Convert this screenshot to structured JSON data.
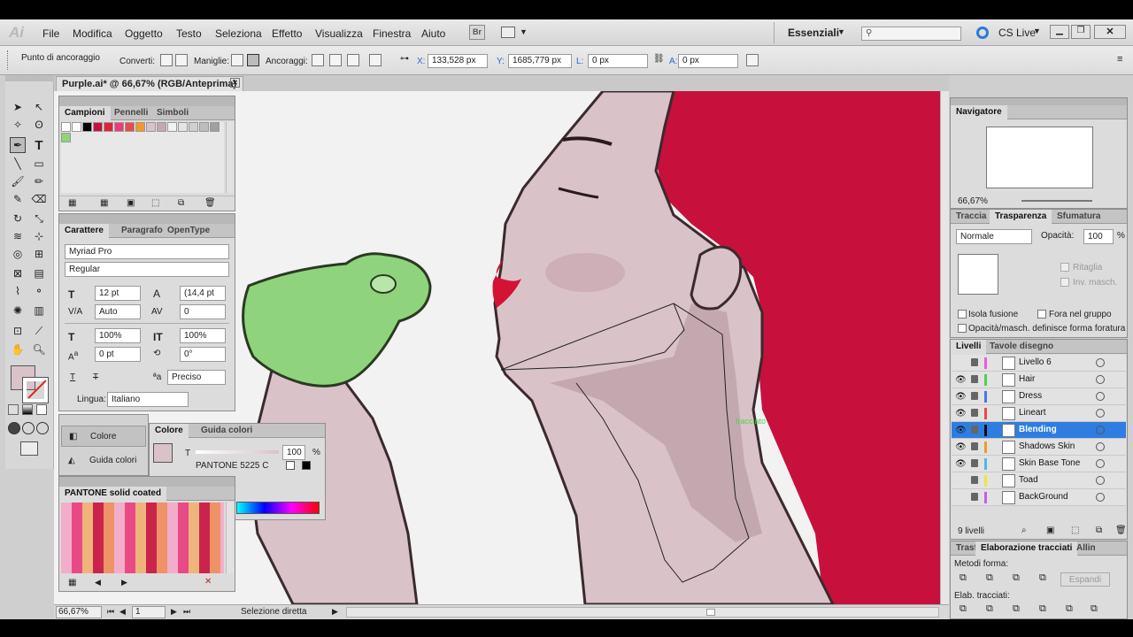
{
  "app": {
    "logo": "Ai",
    "menu": [
      "File",
      "Modifica",
      "Oggetto",
      "Testo",
      "Seleziona",
      "Effetto",
      "Visualizza",
      "Finestra",
      "Aiuto"
    ],
    "workspace_label": "Essenziali",
    "cs_live": "CS Live",
    "bridge_label": "Br"
  },
  "controlbar": {
    "anchor_label": "Punto di ancoraggio",
    "convert_label": "Converti:",
    "handles_label": "Maniglie:",
    "anchors_label": "Ancoraggi:",
    "x_label": "X:",
    "x_value": "133,528 px",
    "y_label": "Y:",
    "y_value": "1685,779 px",
    "w_label": "L:",
    "w_value": "0 px",
    "h_label": "A:",
    "h_value": "0 px"
  },
  "document": {
    "tab_title": "Purple.ai* @ 66,67% (RGB/Anteprima)",
    "path_label": "tracciato"
  },
  "swatches_panel": {
    "tabs": [
      "Campioni",
      "Pennelli",
      "Simboli"
    ]
  },
  "character_panel": {
    "tabs": [
      "Carattere",
      "Paragrafo",
      "OpenType"
    ],
    "font_family": "Myriad Pro",
    "font_style": "Regular",
    "size": "12 pt",
    "leading": "(14,4 pt",
    "kerning": "Auto",
    "tracking": "0",
    "vscale": "100%",
    "hscale": "100%",
    "baseline": "0 pt",
    "rotation": "0°",
    "antialias": "Preciso",
    "language_label": "Lingua:",
    "language": "Italiano"
  },
  "dock": {
    "color_btn": "Colore",
    "guide_btn": "Guida colori"
  },
  "color_panel": {
    "tabs": [
      "Colore",
      "Guida colori"
    ],
    "t_label": "T",
    "tint": "100",
    "percent": "%",
    "swatch_name": "PANTONE 5225 C"
  },
  "pantone_panel": {
    "title": "PANTONE solid coated"
  },
  "navigator": {
    "title": "Navigatore",
    "zoom": "66,67%"
  },
  "transparency": {
    "tabs": [
      "Traccia",
      "Trasparenza",
      "Sfumatura"
    ],
    "mode": "Normale",
    "opacity_label": "Opacità:",
    "opacity": "100",
    "percent": "%",
    "clip_label": "Ritaglia",
    "invert_label": "Inv. masch.",
    "isolate_label": "Isola fusione",
    "knockout_label": "Fora nel gruppo",
    "opacity_mask_label": "Opacità/masch. definisce forma foratura"
  },
  "layers_panel": {
    "tabs": [
      "Livelli",
      "Tavole disegno"
    ],
    "count": "9 livelli",
    "layers": [
      {
        "name": "Livello 6",
        "color": "#f05ad8",
        "visible": false
      },
      {
        "name": "Hair",
        "color": "#4fd24f",
        "visible": true
      },
      {
        "name": "Dress",
        "color": "#4e74e8",
        "visible": true
      },
      {
        "name": "Lineart",
        "color": "#e84b4b",
        "visible": true
      },
      {
        "name": "Blending",
        "color": "#111111",
        "visible": true
      },
      {
        "name": "Shadows Skin",
        "color": "#f09a2a",
        "visible": true
      },
      {
        "name": "Skin Base Tone",
        "color": "#4db8e8",
        "visible": true
      },
      {
        "name": "Toad",
        "color": "#e8e840",
        "visible": false
      },
      {
        "name": "BackGround",
        "color": "#c060e8",
        "visible": false
      }
    ]
  },
  "pathfinder": {
    "tabs": [
      "Trasf",
      "Elaborazione tracciati",
      "Allin"
    ],
    "shape_modes_label": "Metodi forma:",
    "expand_label": "Espandi",
    "pathfinders_label": "Elab. tracciati:"
  },
  "status": {
    "zoom": "66,67%",
    "artboard": "1",
    "tool": "Selezione diretta"
  },
  "colors": {
    "hair": "#c8103c",
    "skin": "#d9c3c8",
    "skin_shadow": "#c4a8b0",
    "toad": "#8fd47c",
    "selection": "#2f7de1"
  }
}
